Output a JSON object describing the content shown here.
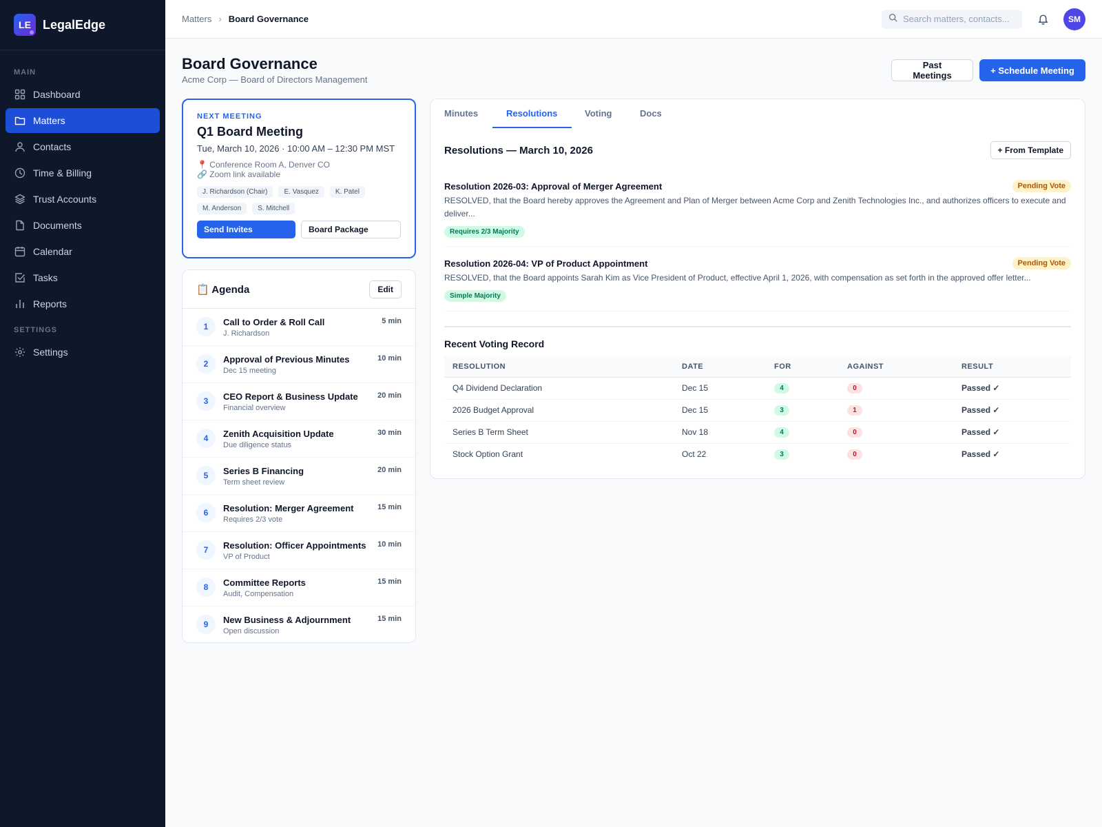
{
  "brand": {
    "logo": "LE",
    "name": "LegalEdge"
  },
  "sidebar": {
    "main_label": "MAIN",
    "items": [
      {
        "label": "Dashboard",
        "icon": "grid-icon"
      },
      {
        "label": "Matters",
        "icon": "folder-icon",
        "active": true
      },
      {
        "label": "Contacts",
        "icon": "user-icon"
      },
      {
        "label": "Time & Billing",
        "icon": "clock-icon"
      },
      {
        "label": "Trust Accounts",
        "icon": "layers-icon"
      },
      {
        "label": "Documents",
        "icon": "file-icon"
      },
      {
        "label": "Calendar",
        "icon": "calendar-icon"
      },
      {
        "label": "Tasks",
        "icon": "check-square-icon"
      },
      {
        "label": "Reports",
        "icon": "bar-chart-icon"
      }
    ],
    "settings_label": "SETTINGS",
    "settings_item": {
      "label": "Settings",
      "icon": "gear-icon"
    }
  },
  "topbar": {
    "breadcrumb": {
      "parent": "Matters",
      "current": "Board Governance"
    },
    "search_placeholder": "Search matters, contacts...",
    "avatar": "SM"
  },
  "header": {
    "title": "Board Governance",
    "subtitle": "Acme Corp — Board of Directors Management",
    "past_meetings": "Past Meetings",
    "schedule": "+ Schedule Meeting"
  },
  "meeting": {
    "label": "NEXT MEETING",
    "title": "Q1 Board Meeting",
    "time": "Tue, March 10, 2026 · 10:00 AM – 12:30 PM MST",
    "location": "📍 Conference Room A, Denver CO",
    "zoom": "🔗 Zoom link available",
    "attendees": [
      "J. Richardson (Chair)",
      "E. Vasquez",
      "K. Patel",
      "M. Anderson",
      "S. Mitchell"
    ],
    "send_invites": "Send Invites",
    "board_package": "Board Package"
  },
  "agenda": {
    "title": "📋 Agenda",
    "edit": "Edit",
    "items": [
      {
        "num": "1",
        "title": "Call to Order & Roll Call",
        "sub": "J. Richardson",
        "dur": "5 min"
      },
      {
        "num": "2",
        "title": "Approval of Previous Minutes",
        "sub": "Dec 15 meeting",
        "dur": "10 min"
      },
      {
        "num": "3",
        "title": "CEO Report & Business Update",
        "sub": "Financial overview",
        "dur": "20 min"
      },
      {
        "num": "4",
        "title": "Zenith Acquisition Update",
        "sub": "Due diligence status",
        "dur": "30 min"
      },
      {
        "num": "5",
        "title": "Series B Financing",
        "sub": "Term sheet review",
        "dur": "20 min"
      },
      {
        "num": "6",
        "title": "Resolution: Merger Agreement",
        "sub": "Requires 2/3 vote",
        "dur": "15 min"
      },
      {
        "num": "7",
        "title": "Resolution: Officer Appointments",
        "sub": "VP of Product",
        "dur": "10 min"
      },
      {
        "num": "8",
        "title": "Committee Reports",
        "sub": "Audit, Compensation",
        "dur": "15 min"
      },
      {
        "num": "9",
        "title": "New Business & Adjournment",
        "sub": "Open discussion",
        "dur": "15 min"
      }
    ]
  },
  "tabs": [
    "Minutes",
    "Resolutions",
    "Voting",
    "Docs"
  ],
  "active_tab": "Resolutions",
  "resolutions": {
    "heading": "Resolutions — March 10, 2026",
    "from_template": "+ From Template",
    "items": [
      {
        "title": "Resolution 2026-03: Approval of Merger Agreement",
        "status": "Pending Vote",
        "text": "RESOLVED, that the Board hereby approves the Agreement and Plan of Merger between Acme Corp and Zenith Technologies Inc., and authorizes officers to execute and deliver...",
        "requirement": "Requires 2/3 Majority"
      },
      {
        "title": "Resolution 2026-04: VP of Product Appointment",
        "status": "Pending Vote",
        "text": "RESOLVED, that the Board appoints Sarah Kim as Vice President of Product, effective April 1, 2026, with compensation as set forth in the approved offer letter...",
        "requirement": "Simple Majority"
      }
    ]
  },
  "voting": {
    "heading": "Recent Voting Record",
    "columns": [
      "RESOLUTION",
      "DATE",
      "FOR",
      "AGAINST",
      "RESULT"
    ],
    "rows": [
      {
        "resolution": "Q4 Dividend Declaration",
        "date": "Dec 15",
        "for": "4",
        "against": "0",
        "result": "Passed ✓"
      },
      {
        "resolution": "2026 Budget Approval",
        "date": "Dec 15",
        "for": "3",
        "against": "1",
        "result": "Passed ✓"
      },
      {
        "resolution": "Series B Term Sheet",
        "date": "Nov 18",
        "for": "4",
        "against": "0",
        "result": "Passed ✓"
      },
      {
        "resolution": "Stock Option Grant",
        "date": "Oct 22",
        "for": "3",
        "against": "0",
        "result": "Passed ✓"
      }
    ]
  },
  "colors": {
    "accent": "#2563eb",
    "sidebar_bg": "#0f172a",
    "pending": "#fef3c7",
    "passed": "#059669"
  }
}
